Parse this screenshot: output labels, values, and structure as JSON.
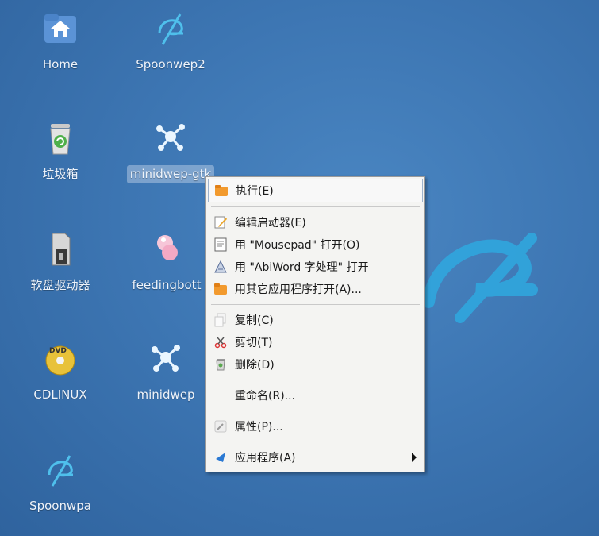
{
  "desktop": {
    "icons": [
      {
        "label": "Home",
        "icon": "home-folder-icon"
      },
      {
        "label": "Spoonwep2",
        "icon": "spoonwep-icon"
      },
      {
        "label": "垃圾箱",
        "icon": "trash-icon"
      },
      {
        "label": "minidwep-gtk",
        "icon": "minidwep-icon"
      },
      {
        "label": "软盘驱动器",
        "icon": "floppy-drive-icon"
      },
      {
        "label": "feedingbott",
        "icon": "feedingbottle-icon"
      },
      {
        "label": "CDLINUX",
        "icon": "dvd-icon"
      },
      {
        "label": "minidwep",
        "icon": "minidwep-icon"
      },
      {
        "label": "Spoonwpa",
        "icon": "spoonwpa-icon"
      }
    ],
    "background_color": "#3d76b3"
  },
  "context_menu": {
    "items": [
      {
        "label": "执行(E)",
        "icon": "folder-run-icon"
      },
      {
        "label": "编辑启动器(E)",
        "icon": "edit-pencil-icon"
      },
      {
        "label": "用 \"Mousepad\" 打开(O)",
        "icon": "text-editor-icon"
      },
      {
        "label": "用 \"AbiWord 字处理\" 打开",
        "icon": "abiword-icon"
      },
      {
        "label": "用其它应用程序打开(A)...",
        "icon": "folder-open-icon"
      },
      {
        "label": "复制(C)",
        "icon": "copy-icon"
      },
      {
        "label": "剪切(T)",
        "icon": "scissors-icon"
      },
      {
        "label": "删除(D)",
        "icon": "trash-small-icon"
      },
      {
        "label": "重命名(R)...",
        "icon": ""
      },
      {
        "label": "属性(P)...",
        "icon": "properties-icon"
      },
      {
        "label": "应用程序(A)",
        "icon": "applications-icon"
      }
    ]
  }
}
